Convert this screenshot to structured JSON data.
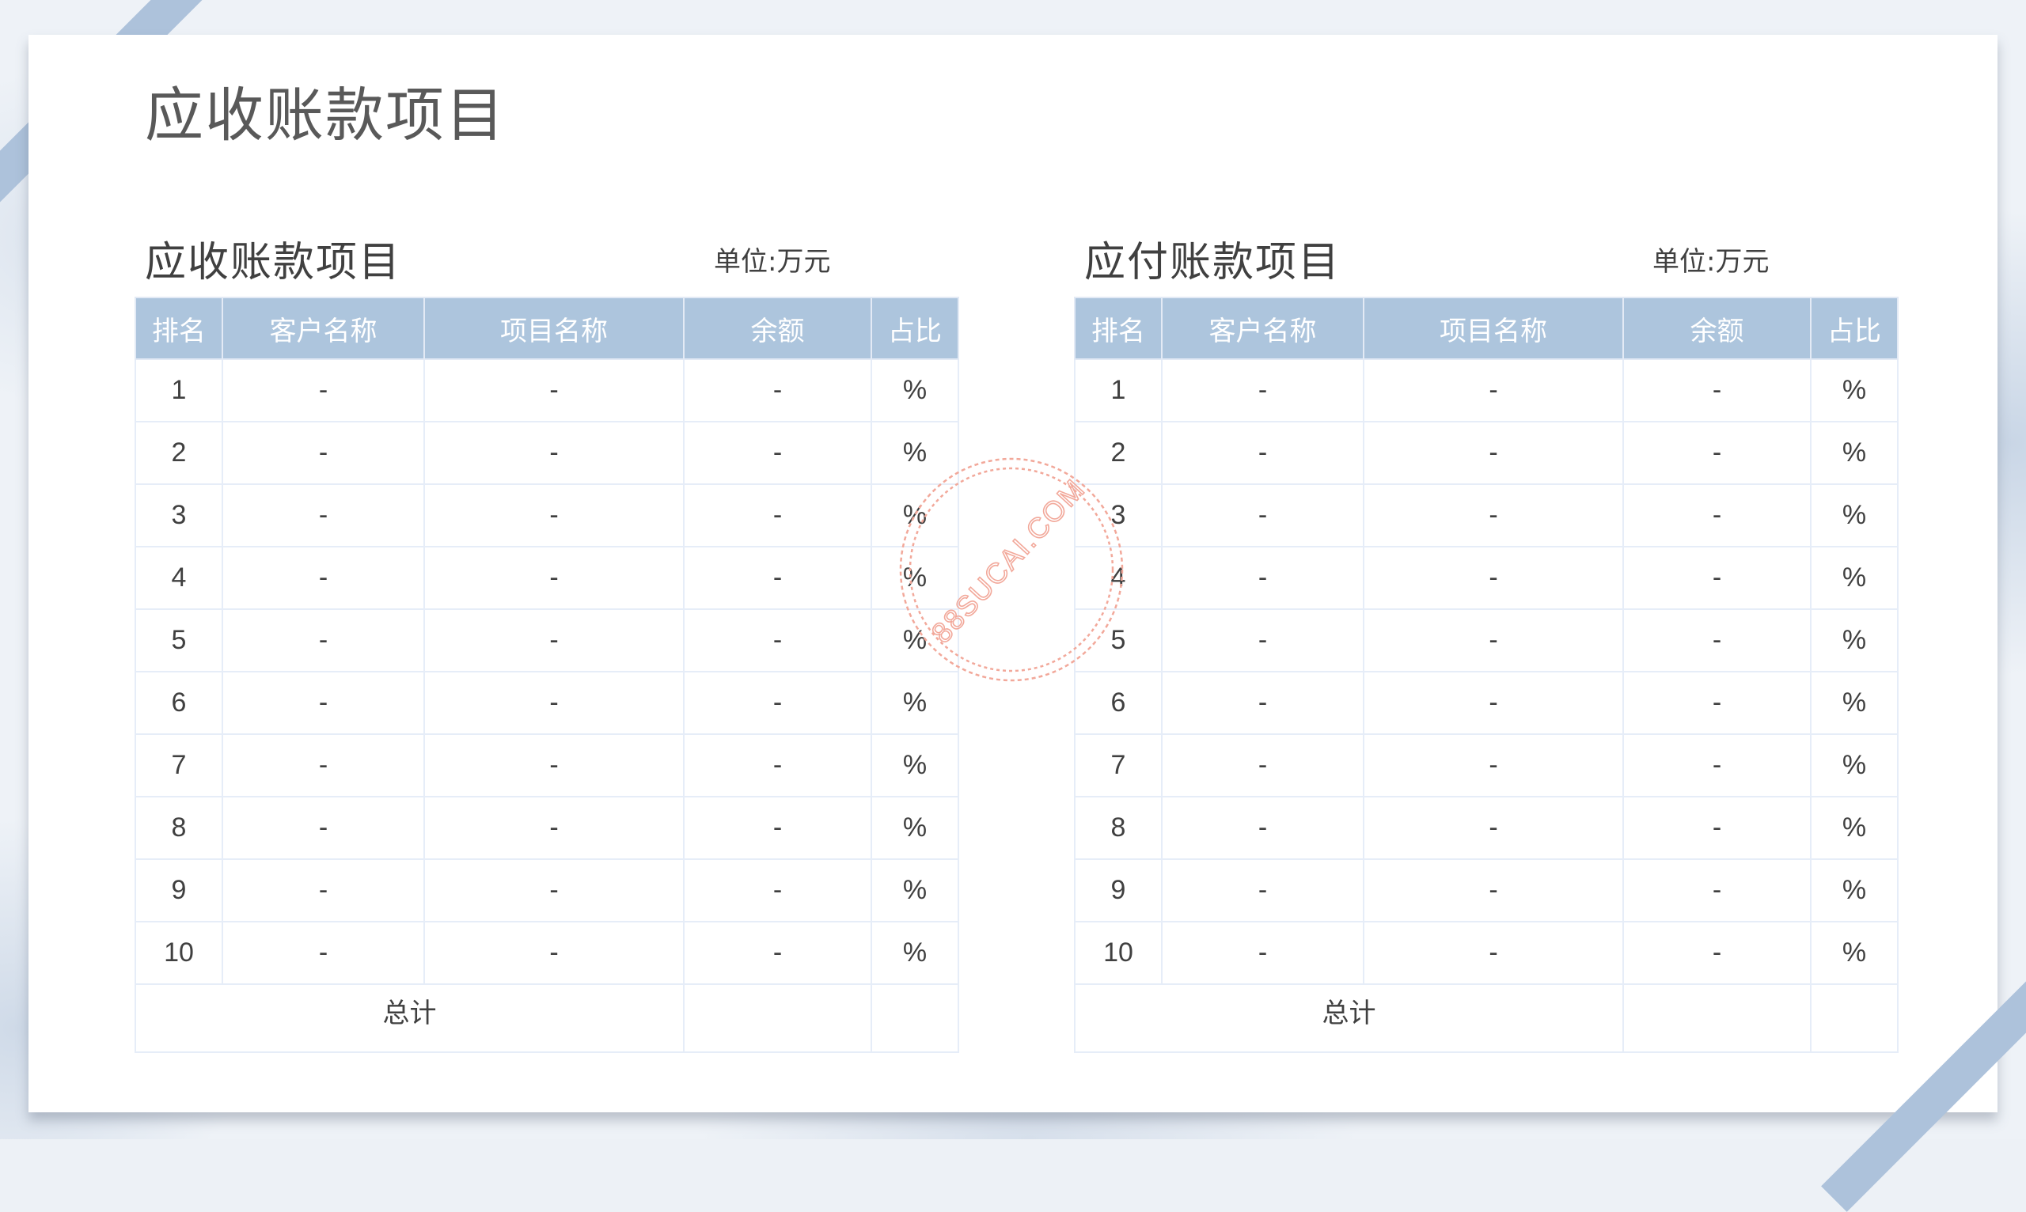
{
  "page_title": "应收账款项目",
  "tables": [
    {
      "title": "应收账款项目",
      "unit": "单位:万元",
      "headers": [
        "排名",
        "客户名称",
        "项目名称",
        "余额",
        "占比"
      ],
      "rows": [
        [
          "1",
          "-",
          "-",
          "-",
          "%"
        ],
        [
          "2",
          "-",
          "-",
          "-",
          "%"
        ],
        [
          "3",
          "-",
          "-",
          "-",
          "%"
        ],
        [
          "4",
          "-",
          "-",
          "-",
          "%"
        ],
        [
          "5",
          "-",
          "-",
          "-",
          "%"
        ],
        [
          "6",
          "-",
          "-",
          "-",
          "%"
        ],
        [
          "7",
          "-",
          "-",
          "-",
          "%"
        ],
        [
          "8",
          "-",
          "-",
          "-",
          "%"
        ],
        [
          "9",
          "-",
          "-",
          "-",
          "%"
        ],
        [
          "10",
          "-",
          "-",
          "-",
          "%"
        ]
      ],
      "total_label": "总计"
    },
    {
      "title": "应付账款项目",
      "unit": "单位:万元",
      "headers": [
        "排名",
        "客户名称",
        "项目名称",
        "余额",
        "占比"
      ],
      "rows": [
        [
          "1",
          "-",
          "-",
          "-",
          "%"
        ],
        [
          "2",
          "-",
          "-",
          "-",
          "%"
        ],
        [
          "3",
          "-",
          "-",
          "-",
          "%"
        ],
        [
          "4",
          "-",
          "-",
          "-",
          "%"
        ],
        [
          "5",
          "-",
          "-",
          "-",
          "%"
        ],
        [
          "6",
          "-",
          "-",
          "-",
          "%"
        ],
        [
          "7",
          "-",
          "-",
          "-",
          "%"
        ],
        [
          "8",
          "-",
          "-",
          "-",
          "%"
        ],
        [
          "9",
          "-",
          "-",
          "-",
          "%"
        ],
        [
          "10",
          "-",
          "-",
          "-",
          "%"
        ]
      ],
      "total_label": "总计"
    }
  ],
  "watermark": "88SUCAI.COM",
  "colors": {
    "header_bg": "#adc5dd",
    "accent_stripe": "#adc2db",
    "watermark": "#f2a89a"
  }
}
